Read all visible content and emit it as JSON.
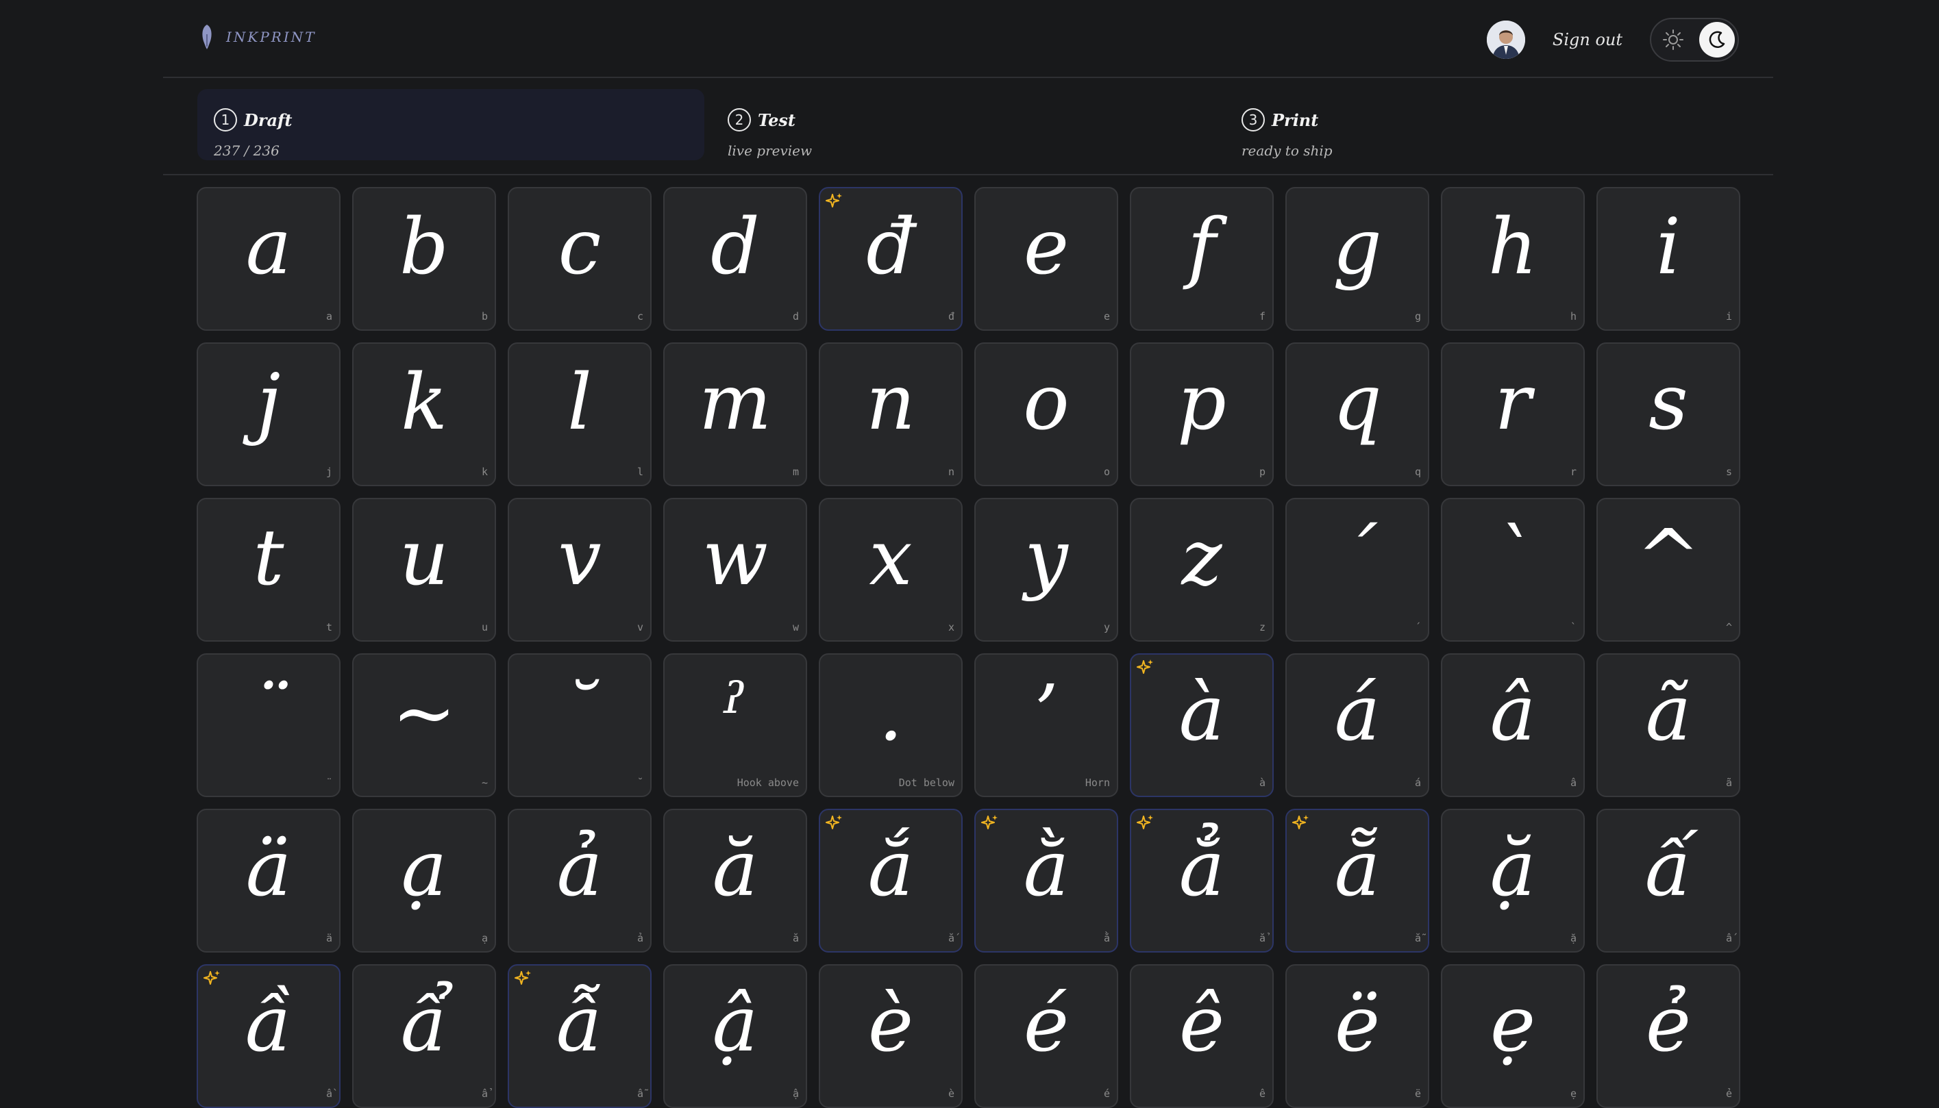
{
  "app": {
    "brand": "INKPRINT",
    "signout": "Sign out"
  },
  "colors": {
    "accent": "#8f96c4",
    "spark": "#f2b520",
    "flag_border": "#2c3566"
  },
  "steps": [
    {
      "num": "1",
      "title": "Draft",
      "sub": "237 / 236"
    },
    {
      "num": "2",
      "title": "Test",
      "sub": "live preview"
    },
    {
      "num": "3",
      "title": "Print",
      "sub": "ready to ship"
    }
  ],
  "tiles": [
    {
      "g": "a",
      "l": "a",
      "f": false
    },
    {
      "g": "b",
      "l": "b",
      "f": false
    },
    {
      "g": "c",
      "l": "c",
      "f": false
    },
    {
      "g": "d",
      "l": "d",
      "f": false
    },
    {
      "g": "đ",
      "l": "đ",
      "f": true
    },
    {
      "g": "e",
      "l": "e",
      "f": false
    },
    {
      "g": "f",
      "l": "f",
      "f": false
    },
    {
      "g": "g",
      "l": "g",
      "f": false
    },
    {
      "g": "h",
      "l": "h",
      "f": false
    },
    {
      "g": "i",
      "l": "i",
      "f": false
    },
    {
      "g": "j",
      "l": "j",
      "f": false
    },
    {
      "g": "k",
      "l": "k",
      "f": false
    },
    {
      "g": "l",
      "l": "l",
      "f": false
    },
    {
      "g": "m",
      "l": "m",
      "f": false
    },
    {
      "g": "n",
      "l": "n",
      "f": false
    },
    {
      "g": "o",
      "l": "o",
      "f": false
    },
    {
      "g": "p",
      "l": "p",
      "f": false
    },
    {
      "g": "q",
      "l": "q",
      "f": false
    },
    {
      "g": "r",
      "l": "r",
      "f": false
    },
    {
      "g": "s",
      "l": "s",
      "f": false
    },
    {
      "g": "t",
      "l": "t",
      "f": false
    },
    {
      "g": "u",
      "l": "u",
      "f": false
    },
    {
      "g": "v",
      "l": "v",
      "f": false
    },
    {
      "g": "w",
      "l": "w",
      "f": false
    },
    {
      "g": "x",
      "l": "x",
      "f": false
    },
    {
      "g": "y",
      "l": "y",
      "f": false
    },
    {
      "g": "z",
      "l": "z",
      "f": false
    },
    {
      "g": "´",
      "l": "´",
      "f": false
    },
    {
      "g": "`",
      "l": "`",
      "f": false
    },
    {
      "g": "^",
      "l": "^",
      "f": false
    },
    {
      "g": "¨",
      "l": "¨",
      "f": false
    },
    {
      "g": "~",
      "l": "~",
      "f": false
    },
    {
      "g": "˘",
      "l": "˘",
      "f": false
    },
    {
      "g": "ˀ",
      "l": "Hook above",
      "f": false
    },
    {
      "g": ".",
      "l": "Dot below",
      "f": false
    },
    {
      "g": "’",
      "l": "Horn",
      "f": false
    },
    {
      "g": "à",
      "l": "à",
      "f": true
    },
    {
      "g": "á",
      "l": "á",
      "f": false
    },
    {
      "g": "â",
      "l": "â",
      "f": false
    },
    {
      "g": "ã",
      "l": "ã",
      "f": false
    },
    {
      "g": "ä",
      "l": "ä",
      "f": false
    },
    {
      "g": "ạ",
      "l": "ạ",
      "f": false
    },
    {
      "g": "ả",
      "l": "ả",
      "f": false
    },
    {
      "g": "ă",
      "l": "ă",
      "f": false
    },
    {
      "g": "ắ",
      "l": "ắ",
      "f": true
    },
    {
      "g": "ằ",
      "l": "ằ",
      "f": true
    },
    {
      "g": "ẳ",
      "l": "ẳ",
      "f": true
    },
    {
      "g": "ẵ",
      "l": "ẵ",
      "f": true
    },
    {
      "g": "ặ",
      "l": "ặ",
      "f": false
    },
    {
      "g": "ấ",
      "l": "ấ",
      "f": false
    },
    {
      "g": "ầ",
      "l": "ầ",
      "f": true
    },
    {
      "g": "ẩ",
      "l": "ẩ",
      "f": false
    },
    {
      "g": "ẫ",
      "l": "ẫ",
      "f": true
    },
    {
      "g": "ậ",
      "l": "ậ",
      "f": false
    },
    {
      "g": "è",
      "l": "è",
      "f": false
    },
    {
      "g": "é",
      "l": "é",
      "f": false
    },
    {
      "g": "ê",
      "l": "ê",
      "f": false
    },
    {
      "g": "ë",
      "l": "ë",
      "f": false
    },
    {
      "g": "ẹ",
      "l": "ẹ",
      "f": false
    },
    {
      "g": "ẻ",
      "l": "ẻ",
      "f": false
    }
  ]
}
